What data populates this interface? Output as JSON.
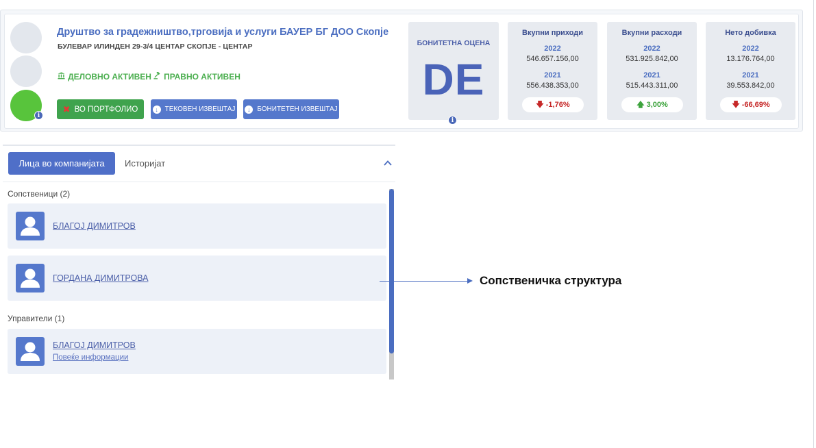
{
  "company": {
    "name": "Друштво за градежништво,трговија и услуги БАУЕР БГ ДОО Скопје",
    "address": "БУЛЕВАР ИЛИНДЕН 29-3/4 ЦЕНТАР СКОПЈЕ - ЦЕНТАР",
    "status_business": "ДЕЛОВНО АКТИВЕН",
    "status_legal": "ПРАВНО АКТИВЕН"
  },
  "buttons": {
    "portfolio": "ВО ПОРТФОЛИО",
    "current_report": "ТЕКОВЕН ИЗВЕШТАЈ",
    "rating_report": "БОНИТЕТЕН ИЗВЕШТАЈ"
  },
  "score": {
    "label": "БОНИТЕТНА ОЦЕНА",
    "value": "DE"
  },
  "financials": [
    {
      "title": "Вкупни приходи",
      "year1": "2022",
      "value1": "546.657.156,00",
      "year2": "2021",
      "value2": "556.438.353,00",
      "change": "-1,76%",
      "direction": "down"
    },
    {
      "title": "Вкупни расходи",
      "year1": "2022",
      "value1": "531.925.842,00",
      "year2": "2021",
      "value2": "515.443.311,00",
      "change": "3,00%",
      "direction": "up"
    },
    {
      "title": "Нето добивка",
      "year1": "2022",
      "value1": "13.176.764,00",
      "year2": "2021",
      "value2": "39.553.842,00",
      "change": "-66,69%",
      "direction": "down"
    }
  ],
  "tabs": {
    "people": "Лица во компанијата",
    "history": "Историјат"
  },
  "sections": {
    "owners": "Сопственици (2)",
    "managers": "Управители (1)"
  },
  "owners": [
    {
      "name": "БЛАГОЈ ДИМИТРОВ"
    },
    {
      "name": "ГОРДАНА ДИМИТРОВА"
    }
  ],
  "managers": [
    {
      "name": "БЛАГОЈ ДИМИТРОВ",
      "more": "Повеќе информации"
    }
  ],
  "annotation": "Сопственичка структура",
  "colors": {
    "primary": "#5578cc",
    "success": "#3fa34d",
    "negative": "#c62828",
    "positive": "#3ca33c",
    "status_green": "#4caf50",
    "rating_circle": "#58c43c"
  },
  "icons": {
    "status_business": "bank-icon",
    "status_legal": "gavel-icon",
    "portfolio": "close-icon",
    "download": "download-circle-icon",
    "info": "info-icon",
    "collapse": "chevron-up-icon",
    "avatar": "person-icon"
  }
}
